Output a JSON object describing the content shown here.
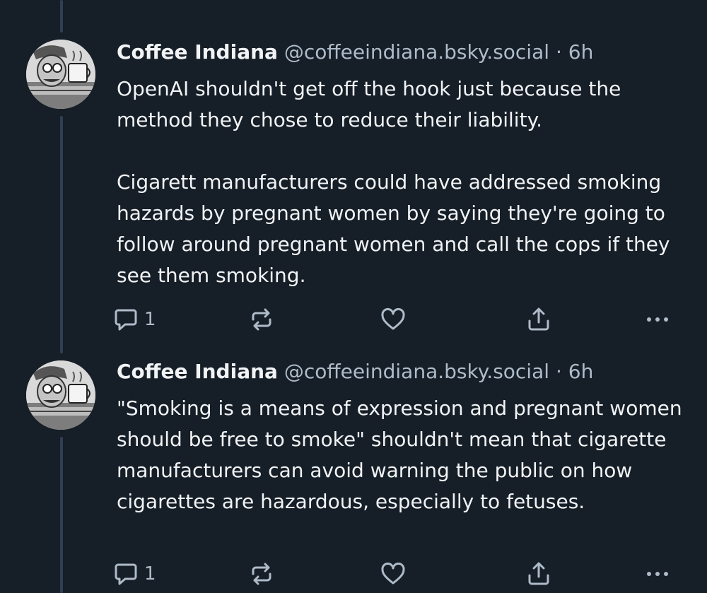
{
  "posts": [
    {
      "author": "Coffee Indiana",
      "handle": "@coffeeindiana.bsky.social",
      "separator": "·",
      "time": "6h",
      "paragraphs": [
        "OpenAI shouldn't get off the hook just because the method they chose to reduce their liability.",
        "Cigarett manufacturers could have addressed smoking hazards by pregnant women by saying they're going to follow around pregnant women and call the cops if they see them smoking."
      ],
      "reply_count": "1"
    },
    {
      "author": "Coffee Indiana",
      "handle": "@coffeeindiana.bsky.social",
      "separator": "·",
      "time": "6h",
      "paragraphs": [
        "\"Smoking is a means of expression and pregnant women should be free to smoke\" shouldn't mean that cigarette manufacturers can avoid warning the public on how cigarettes are hazardous, especially to fetuses."
      ],
      "reply_count": "1"
    }
  ],
  "icons": {
    "reply": "reply-icon",
    "repost": "repost-icon",
    "like": "heart-icon",
    "share": "share-icon",
    "more": "more-icon"
  },
  "colors": {
    "background": "#161e27",
    "text": "#f1f3f5",
    "muted": "#aebbc9",
    "thread_line": "#2e4052"
  }
}
